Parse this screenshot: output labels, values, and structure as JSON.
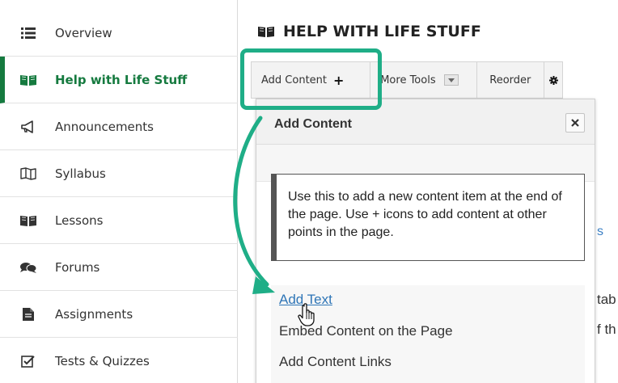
{
  "sidebar": {
    "items": [
      {
        "label": "Overview",
        "icon": "list-icon",
        "active": false
      },
      {
        "label": "Help with Life Stuff",
        "icon": "book-icon",
        "active": true
      },
      {
        "label": "Announcements",
        "icon": "megaphone-icon",
        "active": false
      },
      {
        "label": "Syllabus",
        "icon": "map-icon",
        "active": false
      },
      {
        "label": "Lessons",
        "icon": "book-icon",
        "active": false
      },
      {
        "label": "Forums",
        "icon": "comments-icon",
        "active": false
      },
      {
        "label": "Assignments",
        "icon": "file-icon",
        "active": false
      },
      {
        "label": "Tests & Quizzes",
        "icon": "checkbox-icon",
        "active": false
      }
    ]
  },
  "page": {
    "title": "HELP WITH LIFE STUFF",
    "title_icon": "book-icon"
  },
  "toolbar": {
    "add_content_label": "Add Content",
    "add_content_icon": "+",
    "more_tools_label": "More Tools",
    "reorder_label": "Reorder",
    "settings_icon": "gear-icon"
  },
  "panel": {
    "title": "Add Content",
    "close_icon": "close-icon",
    "info_text": "Use this to add a new content item at the end of the page. Use + icons to add content at other points in the page.",
    "links": [
      "Add Text",
      "Embed Content on the Page",
      "Add Content Links"
    ]
  },
  "background": {
    "peek_link_char": "s",
    "peek_line_1": "tab",
    "peek_line_2": "f th"
  },
  "colors": {
    "accent_green": "#157a3f",
    "highlight_teal": "#1fae87",
    "link_blue": "#2f76b7"
  }
}
